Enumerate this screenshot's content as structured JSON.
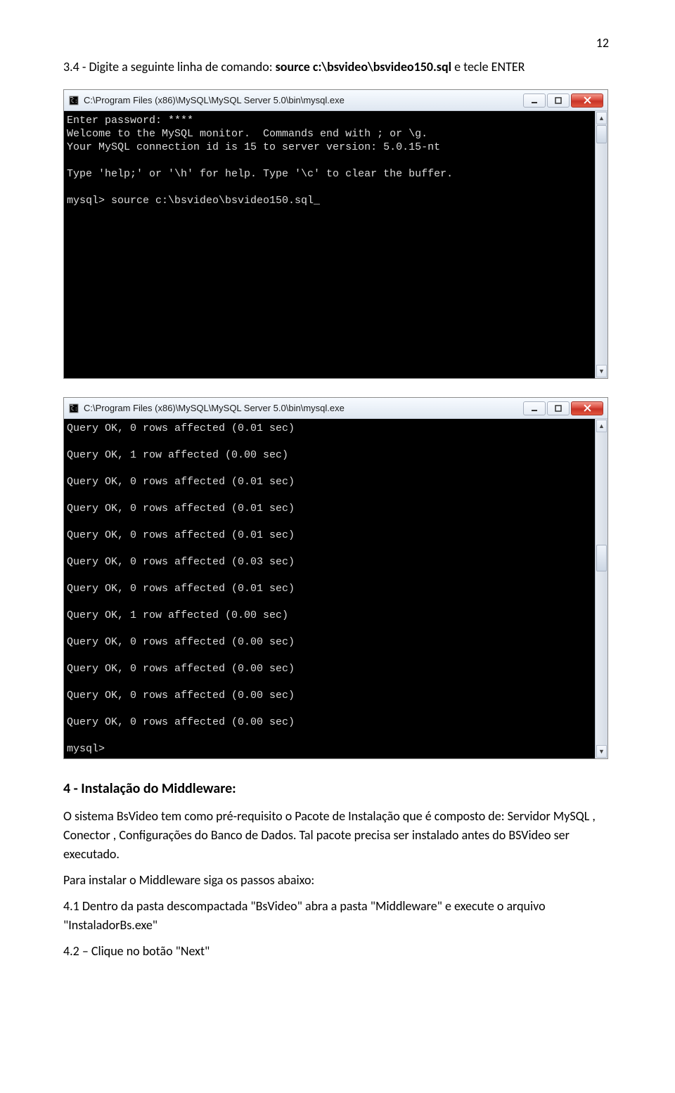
{
  "page_number": "12",
  "paragraphs": {
    "p1_prefix": "3.4 - Digite a seguinte linha de comando: ",
    "p1_bold": "source c:\\bsvideo\\bsvideo150.sql",
    "p1_suffix": " e tecle ENTER"
  },
  "section4_title": "4 - Instalação do Middleware:",
  "section4_body1": "O sistema BsVideo tem como pré-requisito o Pacote de Instalação que é composto de: Servidor MySQL , Conector , Configurações do Banco de Dados. Tal pacote precisa ser instalado antes do BSVideo ser executado.",
  "section4_body2": "Para instalar o Middleware siga os passos abaixo:",
  "section4_body3": "4.1 Dentro da pasta descompactada \"BsVideo\" abra a pasta \"Middleware\" e execute o arquivo \"InstaladorBs.exe\"",
  "section4_body4": "4.2 – Clique no botão \"Next\"",
  "window1": {
    "title": "C:\\Program Files (x86)\\MySQL\\MySQL Server 5.0\\bin\\mysql.exe",
    "lines": [
      "Enter password: ****",
      "Welcome to the MySQL monitor.  Commands end with ; or \\g.",
      "Your MySQL connection id is 15 to server version: 5.0.15-nt",
      "",
      "Type 'help;' or '\\h' for help. Type '\\c' to clear the buffer.",
      "",
      "mysql> source c:\\bsvideo\\bsvideo150.sql_"
    ]
  },
  "window2": {
    "title": "C:\\Program Files (x86)\\MySQL\\MySQL Server 5.0\\bin\\mysql.exe",
    "lines": [
      "Query OK, 0 rows affected (0.01 sec)",
      "",
      "Query OK, 1 row affected (0.00 sec)",
      "",
      "Query OK, 0 rows affected (0.01 sec)",
      "",
      "Query OK, 0 rows affected (0.01 sec)",
      "",
      "Query OK, 0 rows affected (0.01 sec)",
      "",
      "Query OK, 0 rows affected (0.03 sec)",
      "",
      "Query OK, 0 rows affected (0.01 sec)",
      "",
      "Query OK, 1 row affected (0.00 sec)",
      "",
      "Query OK, 0 rows affected (0.00 sec)",
      "",
      "Query OK, 0 rows affected (0.00 sec)",
      "",
      "Query OK, 0 rows affected (0.00 sec)",
      "",
      "Query OK, 0 rows affected (0.00 sec)",
      "",
      "mysql>"
    ]
  }
}
